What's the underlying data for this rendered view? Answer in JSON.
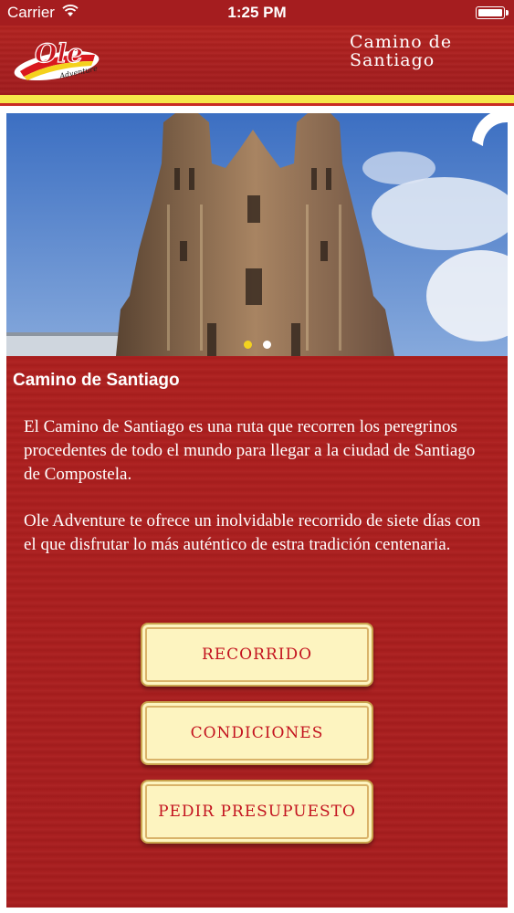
{
  "status_bar": {
    "carrier": "Carrier",
    "time": "1:25 PM"
  },
  "header": {
    "logo_text": "Ole",
    "logo_subtext": "Adventure",
    "title_line1": "Camino de",
    "title_line2": "Santiago"
  },
  "hero": {
    "image_subject": "Cathedral of Santiago de Compostela",
    "carousel_pages": 2,
    "carousel_active": 1
  },
  "content": {
    "section_title": "Camino de Santiago",
    "paragraph_1": "El Camino de Santiago es una ruta que recorren los peregrinos procedentes de todo el mundo para llegar a la ciudad de Santiago de Compostela.",
    "paragraph_2": "Ole Adventure te ofrece un inolvidable recorrido de siete días con el que disfrutar lo más auténtico de estra tradición centenaria."
  },
  "buttons": {
    "recorrido": "RECORRIDO",
    "condiciones": "CONDICIONES",
    "presupuesto": "PEDIR PRESUPUESTO"
  },
  "colors": {
    "header_red": "#a51d1f",
    "stripe_yellow": "#f6e84a",
    "button_fill": "#fdf4c0",
    "button_text": "#c3131f",
    "carousel_active_dot": "#f3d21f"
  }
}
